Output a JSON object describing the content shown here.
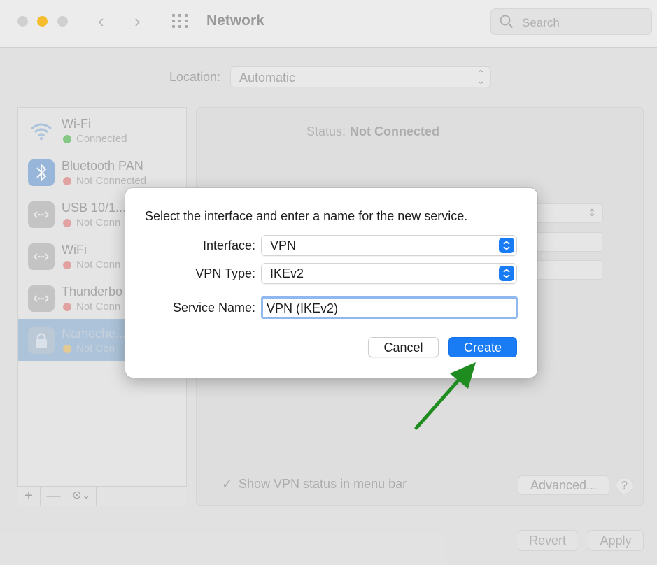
{
  "window": {
    "title": "Network",
    "search_placeholder": "Search",
    "nav_back": "‹",
    "nav_forward": "›"
  },
  "location": {
    "label": "Location:",
    "value": "Automatic"
  },
  "services": [
    {
      "name": "Wi-Fi",
      "status": "Connected",
      "icon": "wifi-icon",
      "status_color": "#78c878"
    },
    {
      "name": "Bluetooth PAN",
      "status": "Not Connected",
      "icon": "bluetooth-icon",
      "status_color": "#e79c9c"
    },
    {
      "name": "USB 10/1...",
      "status": "Not Conn",
      "icon": "ethernet-icon",
      "status_color": "#e79c9c"
    },
    {
      "name": "WiFi",
      "status": "Not Conn",
      "icon": "ethernet-icon",
      "status_color": "#e79c9c"
    },
    {
      "name": "Thunderbo",
      "status": "Not Conn",
      "icon": "ethernet-icon",
      "status_color": "#e79c9c"
    },
    {
      "name": "Nameche...",
      "status": "Not Con",
      "icon": "lock-icon",
      "status_color": "#e8c98a"
    }
  ],
  "sidebar_toolbar": {
    "add": "+",
    "remove": "—",
    "action": "⊙⌄"
  },
  "panel": {
    "status_label": "Status:",
    "status_value": "Not Connected",
    "show_vpn_check": "✓",
    "show_vpn_label": "Show VPN status in menu bar",
    "advanced": "Advanced...",
    "help": "?"
  },
  "footer": {
    "revert": "Revert",
    "apply": "Apply"
  },
  "dialog": {
    "message": "Select the interface and enter a name for the new service.",
    "interface_label": "Interface:",
    "interface_value": "VPN",
    "vpn_type_label": "VPN Type:",
    "vpn_type_value": "IKEv2",
    "service_name_label": "Service Name:",
    "service_name_value": "VPN (IKEv2)",
    "cancel": "Cancel",
    "create": "Create"
  },
  "colors": {
    "accent": "#1a7cf5",
    "annotation_arrow": "#1f8c1f"
  }
}
